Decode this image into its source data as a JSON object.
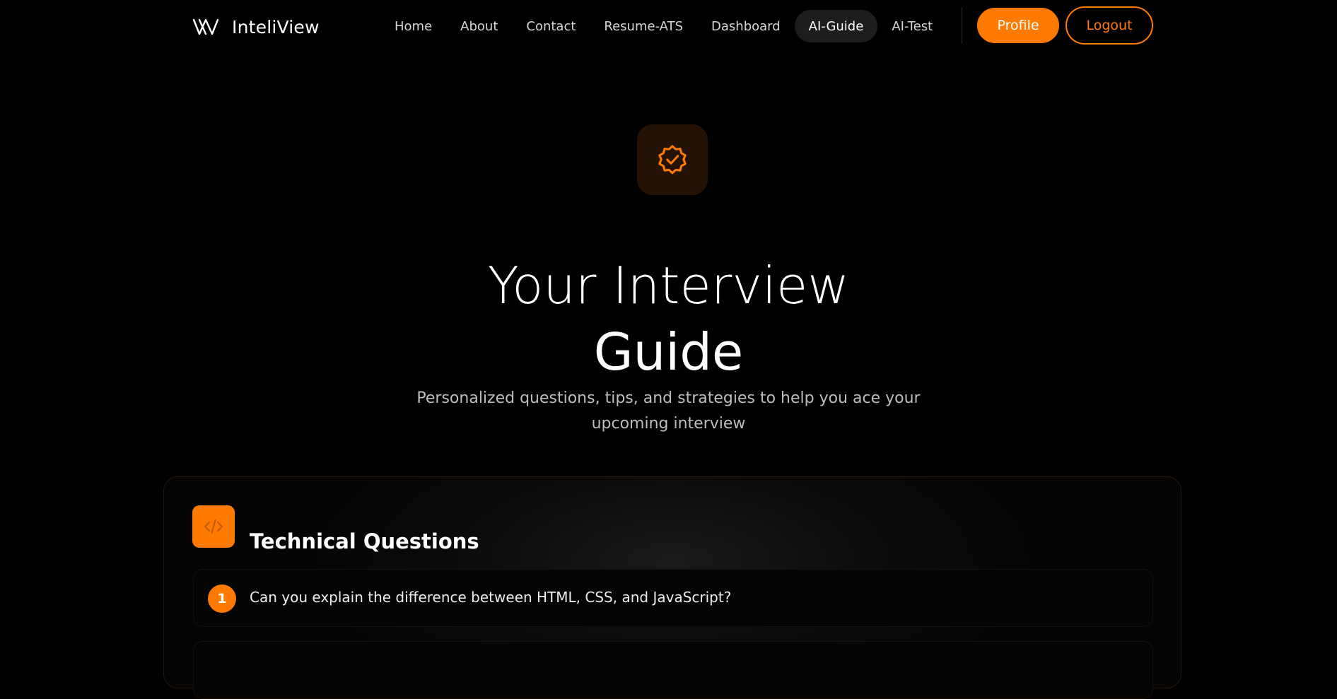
{
  "brand": {
    "name": "InteliView",
    "logo_icon": "w-logo-icon"
  },
  "nav": {
    "links": [
      {
        "label": "Home",
        "active": false
      },
      {
        "label": "About",
        "active": false
      },
      {
        "label": "Contact",
        "active": false
      },
      {
        "label": "Resume-ATS",
        "active": false
      },
      {
        "label": "Dashboard",
        "active": false
      },
      {
        "label": "AI-Guide",
        "active": true
      },
      {
        "label": "AI-Test",
        "active": false
      }
    ],
    "profile_label": "Profile",
    "logout_label": "Logout"
  },
  "hero": {
    "badge_icon": "verified-badge-icon",
    "title_line1": "Your Interview",
    "title_line2": "Guide",
    "subtitle": "Personalized questions, tips, and strategies to help you ace your upcoming interview"
  },
  "sections": [
    {
      "icon": "code-icon",
      "title": "Technical Questions",
      "questions": [
        {
          "number": "1",
          "text": "Can you explain the difference between HTML, CSS, and JavaScript?"
        }
      ]
    }
  ],
  "colors": {
    "accent": "#ff7a00",
    "background": "#000000",
    "text": "#ffffff",
    "muted_text": "#bdbdbd",
    "active_nav_bg": "#1d1d1d"
  }
}
